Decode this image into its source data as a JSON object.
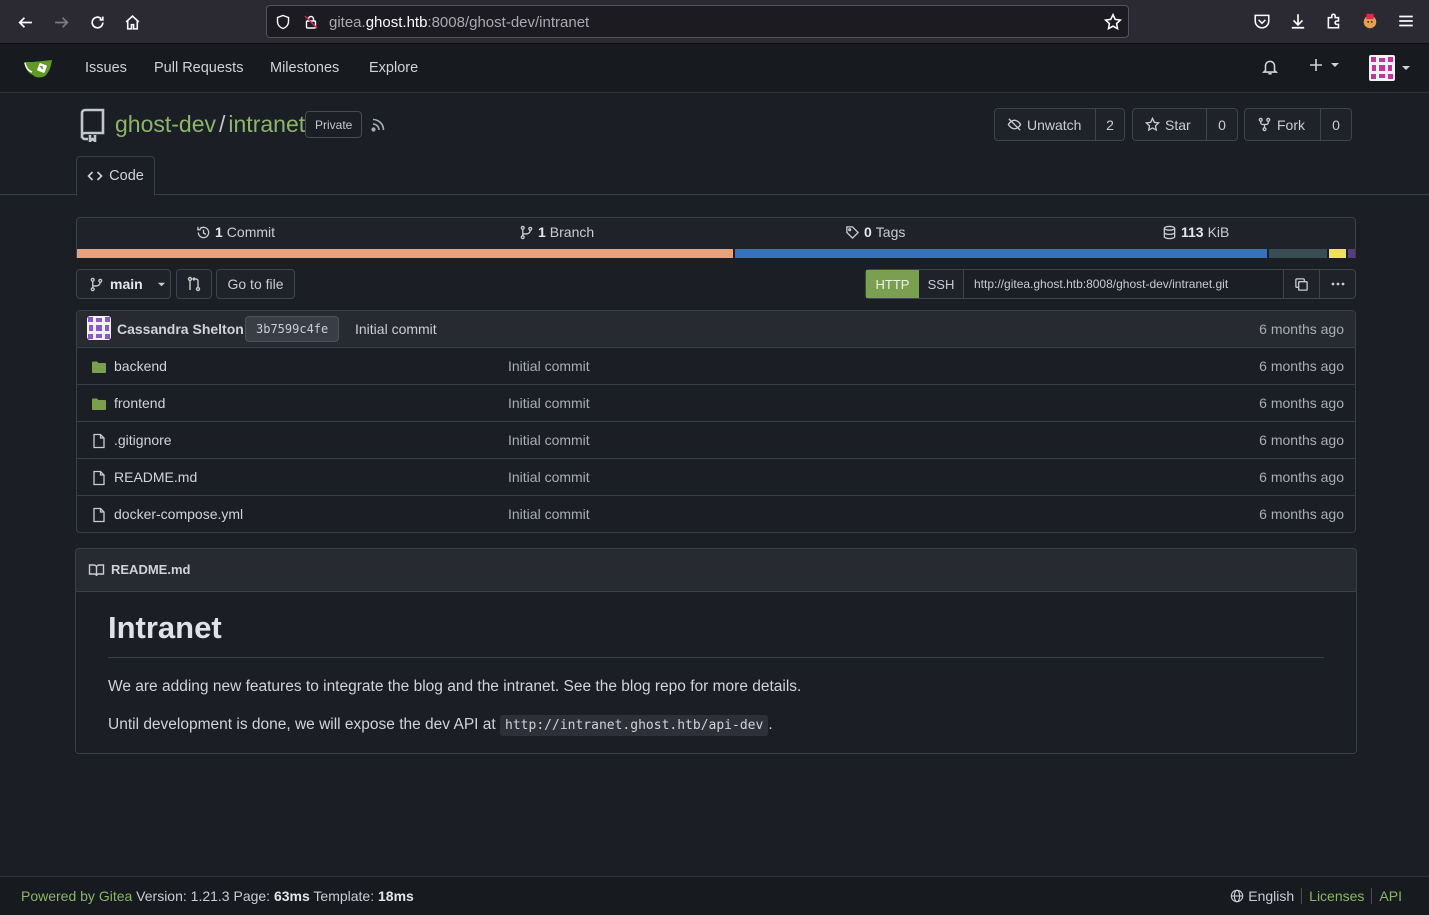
{
  "browser": {
    "url_prefix": "gitea.",
    "url_host": "ghost.htb",
    "url_rest": ":8008/ghost-dev/intranet"
  },
  "nav": {
    "issues": "Issues",
    "pulls": "Pull Requests",
    "milestones": "Milestones",
    "explore": "Explore"
  },
  "repo": {
    "owner": "ghost-dev",
    "separator": "/",
    "name": "intranet",
    "visibility": "Private",
    "unwatch_label": "Unwatch",
    "watch_count": "2",
    "star_label": "Star",
    "star_count": "0",
    "fork_label": "Fork",
    "fork_count": "0",
    "code_tab": "Code"
  },
  "stats": {
    "commits_num": "1",
    "commits_label": "Commit",
    "branches_num": "1",
    "branches_label": "Branch",
    "tags_num": "0",
    "tags_label": "Tags",
    "size_num": "113",
    "size_label": "KiB"
  },
  "languages": [
    {
      "color": "#e7a27b",
      "share": 0.513
    },
    {
      "color": "#3572b8",
      "share": 0.418
    },
    {
      "color": "#384d54",
      "share": 0.047
    },
    {
      "color": "#f1e05a",
      "share": 0.015
    },
    {
      "color": "#563d7c",
      "share": 0.007
    }
  ],
  "toolbar": {
    "branch": "main",
    "go_to_file": "Go to file",
    "http": "HTTP",
    "ssh": "SSH",
    "clone_url": "http://gitea.ghost.htb:8008/ghost-dev/intranet.git"
  },
  "latest_commit": {
    "author": "Cassandra Shelton",
    "sha": "3b7599c4fe",
    "message": "Initial commit",
    "time": "6 months ago"
  },
  "files": [
    {
      "name": "backend",
      "type": "dir",
      "message": "Initial commit",
      "time": "6 months ago"
    },
    {
      "name": "frontend",
      "type": "dir",
      "message": "Initial commit",
      "time": "6 months ago"
    },
    {
      "name": ".gitignore",
      "type": "file",
      "message": "Initial commit",
      "time": "6 months ago"
    },
    {
      "name": "README.md",
      "type": "file",
      "message": "Initial commit",
      "time": "6 months ago"
    },
    {
      "name": "docker-compose.yml",
      "type": "file",
      "message": "Initial commit",
      "time": "6 months ago"
    }
  ],
  "readme": {
    "filename": "README.md",
    "heading": "Intranet",
    "para1": "We are adding new features to integrate the blog and the intranet. See the blog repo for more details.",
    "para2_prefix": "Until development is done, we will expose the dev API at ",
    "para2_code": "http://intranet.ghost.htb/api-dev",
    "para2_suffix": "."
  },
  "footer": {
    "powered": "Powered by Gitea",
    "version_label": " Version: 1.21.3 Page: ",
    "page_time": "63ms",
    "template_label": " Template: ",
    "template_time": "18ms",
    "language": "English",
    "licenses": "Licenses",
    "api": "API"
  }
}
